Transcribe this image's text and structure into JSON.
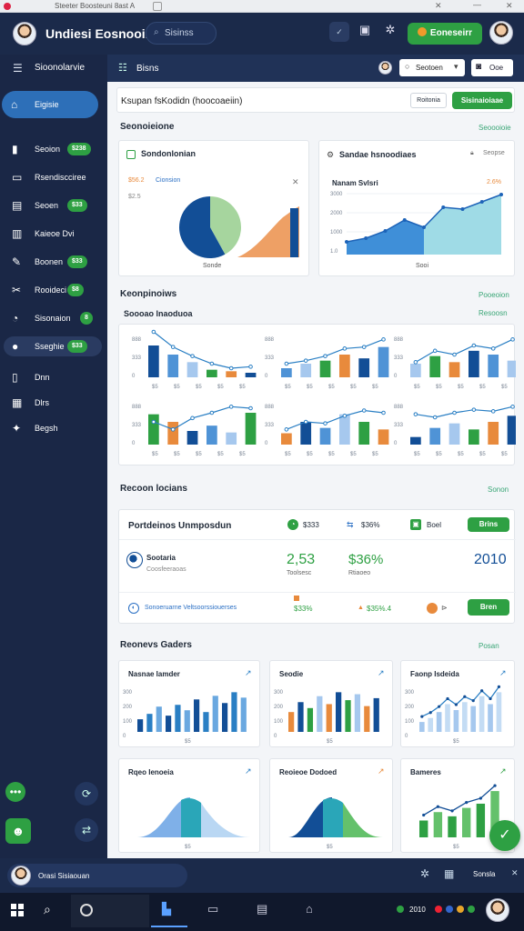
{
  "titlebar": {
    "title": "Steeter Boosteuni 8ast A"
  },
  "topnav": {
    "app_name": "Undiesi Eosnooinn",
    "search_placeholder": "Sisinss",
    "cta_label": "Eoneseirr"
  },
  "sidebar": {
    "header": "Sioonolarvie",
    "items": [
      {
        "label": "Eigisie",
        "icon": "home-icon",
        "active": true
      },
      {
        "label": "Seoion",
        "badge": "$238",
        "icon": "chart-icon"
      },
      {
        "label": "Rsendiscciree",
        "icon": "layers-icon"
      },
      {
        "label": "Seoen",
        "badge": "$33",
        "icon": "doc-icon"
      },
      {
        "label": "Kaieoe Dvi",
        "icon": "calendar-icon"
      },
      {
        "label": "Boonen",
        "badge": "$33",
        "icon": "pen-icon"
      },
      {
        "label": "Rooideci",
        "badge": "$8",
        "icon": "tools-icon"
      },
      {
        "label": "Sisonaion",
        "badge": "8",
        "icon": "gauge-icon"
      },
      {
        "label": "Sseghie",
        "badge": "$33",
        "icon": "user-icon",
        "highlight": true
      },
      {
        "label": "Dnn",
        "icon": "list-icon"
      },
      {
        "label": "Dlrs",
        "icon": "grid-icon"
      },
      {
        "label": "Begsh",
        "icon": "star-icon"
      }
    ]
  },
  "subbar": {
    "title": "Bisns",
    "select_value": "Seotoen",
    "chat_label": "Ooe"
  },
  "header_row": {
    "title": "Ksupan fsKodidn (hoocoaeiin)",
    "btn1": "Roitonia",
    "btn2": "Sisinaioiaae"
  },
  "section1": {
    "title": "Seonoieione",
    "link": "Seoooioie",
    "card1": {
      "title": "Sondonlonian",
      "legend_a": "$56.2",
      "legend_b": "Cionsion",
      "label": "$2.5",
      "xlabel": "Sonde",
      "chart_data": {
        "type": "pie",
        "slices": [
          {
            "name": "A",
            "value": 42,
            "color": "#a6d59e"
          },
          {
            "name": "B",
            "value": 58,
            "color": "#124e96"
          }
        ]
      }
    },
    "card2": {
      "title": "Sandae hsnoodiaes",
      "right": "Seopse",
      "sub": "Nanam Svlsri",
      "legend": "2.6%",
      "xlabel": "Sooi",
      "ylabels": [
        "3000",
        "2000",
        "1000",
        "1.0"
      ],
      "chart_data": {
        "type": "area",
        "x": [
          1,
          2,
          3,
          4,
          5,
          6,
          7,
          8,
          9
        ],
        "series": [
          {
            "values": [
              700,
              900,
              1300,
              1900,
              1500,
              2600,
              2500,
              2900,
              3300
            ]
          }
        ],
        "ylim": [
          0,
          3500
        ]
      }
    }
  },
  "section2": {
    "title": "Keonpinoiws",
    "link": "Pooeoion",
    "subtitle": "Soooao lnaoduoa",
    "sublink": "Resoosn",
    "ylabels": [
      "888",
      "333",
      "0"
    ],
    "xlabels": [
      "$5",
      "$5",
      "$5",
      "$5",
      "$5"
    ],
    "chart_data": [
      {
        "type": "bar",
        "values": [
          42,
          30,
          20,
          10,
          8,
          6
        ],
        "line": [
          60,
          40,
          28,
          18,
          12,
          14
        ]
      },
      {
        "type": "bar",
        "values": [
          12,
          18,
          22,
          30,
          25,
          40
        ],
        "line": [
          18,
          22,
          28,
          38,
          40,
          50
        ]
      },
      {
        "type": "bar",
        "values": [
          18,
          28,
          20,
          35,
          30,
          22
        ],
        "line": [
          20,
          35,
          30,
          42,
          38,
          50
        ]
      },
      {
        "type": "bar",
        "values": [
          40,
          30,
          18,
          25,
          16,
          42
        ],
        "line": [
          30,
          20,
          35,
          42,
          50,
          48
        ]
      },
      {
        "type": "bar",
        "values": [
          15,
          30,
          22,
          40,
          30,
          20
        ],
        "line": [
          20,
          30,
          28,
          38,
          45,
          42
        ]
      },
      {
        "type": "bar",
        "values": [
          10,
          22,
          28,
          20,
          30,
          38
        ],
        "line": [
          40,
          36,
          42,
          46,
          44,
          50
        ]
      }
    ],
    "colors": [
      "#124e96",
      "#4f93d6",
      "#a6c8ee",
      "#2ea043",
      "#e88a3c"
    ]
  },
  "section3": {
    "title": "Recoon locians",
    "link": "Sonon",
    "stats_title": "Portdeinos Unmposdun",
    "stat1": "$333",
    "stat2": "$36%",
    "stat3": "Boel",
    "stat_btn": "Brins",
    "left_name": "Sootaria",
    "left_sub": "Coosfeeraoas",
    "big1": "2,53",
    "big1_sub": "Toolsesc",
    "big2": "$36%",
    "big2_sub": "Rtiaoeo",
    "big3": "2010",
    "foot_text": "Sonoeruarne Veltsoorssiouerses",
    "foot_v1": "$33%",
    "foot_v2": "$35%.4",
    "foot_btn": "Bren"
  },
  "section4": {
    "title": "Reonevs Gaders",
    "link": "Posan",
    "cards": [
      {
        "title": "Nasnae Iamder",
        "type": "bar",
        "values": [
          14,
          20,
          28,
          18,
          30,
          24,
          36,
          22,
          40,
          32,
          44,
          38
        ],
        "palette": "blue"
      },
      {
        "title": "Seodie",
        "type": "bar",
        "values": [
          20,
          30,
          24,
          36,
          28,
          40,
          32,
          38,
          26,
          34
        ],
        "palette": "mixed"
      },
      {
        "title": "Faonp Isdeida",
        "type": "bararea",
        "values": [
          10,
          14,
          20,
          28,
          22,
          30,
          26,
          36,
          28,
          40
        ],
        "palette": "light"
      },
      {
        "title": "Rqeo Ienoeia",
        "type": "bell",
        "palette": "blue-teal"
      },
      {
        "title": "Reoieoe Dodoed",
        "type": "bell",
        "palette": "navy-green"
      },
      {
        "title": "Bameres",
        "type": "barline",
        "values": [
          8,
          12,
          10,
          14,
          16,
          22
        ],
        "palette": "green"
      }
    ],
    "chart_data": [
      {
        "type": "bar",
        "values": [
          14,
          20,
          28,
          18,
          30,
          24,
          36,
          22,
          40,
          32,
          44,
          38
        ]
      },
      {
        "type": "bar",
        "values": [
          20,
          30,
          24,
          36,
          28,
          40,
          32,
          38,
          26,
          34
        ]
      },
      {
        "type": "area",
        "values": [
          10,
          14,
          20,
          28,
          22,
          30,
          26,
          36,
          28,
          40
        ]
      },
      {
        "type": "area",
        "values": [
          5,
          15,
          40,
          55,
          35,
          15
        ]
      },
      {
        "type": "area",
        "values": [
          5,
          20,
          45,
          50,
          30,
          10
        ]
      },
      {
        "type": "bar",
        "values": [
          8,
          12,
          10,
          14,
          16,
          22
        ]
      }
    ],
    "ylabels": [
      "300",
      "200",
      "100",
      "0"
    ]
  },
  "bottombar": {
    "user": "Orasi Sisiaouan",
    "right_label": "Sonsla"
  },
  "taskbar": {
    "time": "2010"
  }
}
